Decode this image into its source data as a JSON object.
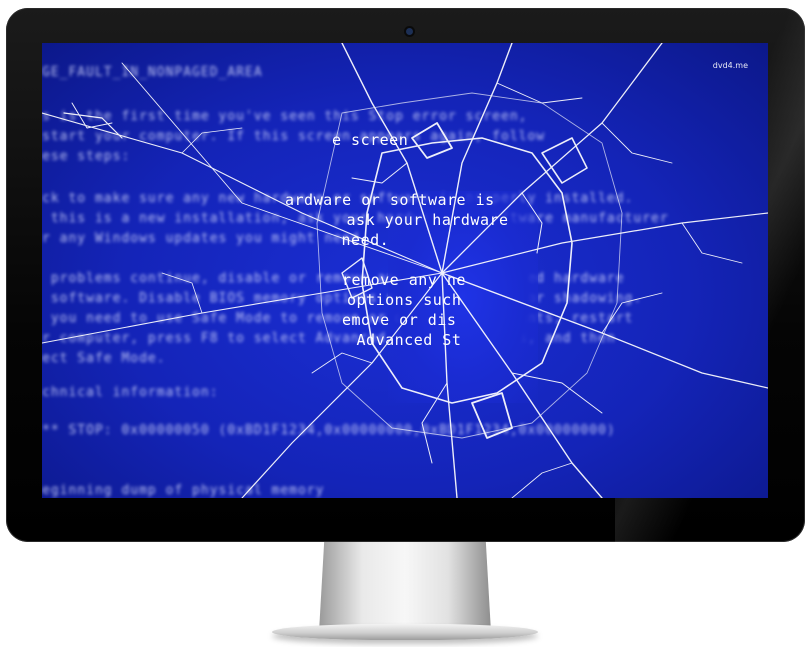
{
  "screen": {
    "watermark": "dvd4.me",
    "blurred_lines": [
      "GE_FAULT_IN_NONPAGED_AREA",
      "s is the first time you've seen this Stop error screen,",
      "start your computer. If this screen appears again, follow",
      "ese steps:",
      "ck to make sure any new hardware or software is properly installed.",
      " this is a new installation, ask your hardware or software manufacturer",
      "r any Windows updates you might need.",
      " problems continue, disable or remove any newly installed hardware",
      " software. Disable BIOS memory options such as caching or shadowing.",
      " you need to use Safe Mode to remove or disable components, restart",
      "r computer, press F8 to select Advanced Startup Options, and then",
      "ect Safe Mode.",
      "chnical information:",
      "** STOP: 0x00000050 (0xBD1F1234,0x00000000,0xBD1F1234,0x00000000)",
      "eginning dump of physical memory"
    ],
    "sharp_lines": [
      "e screen",
      "ardware or software is",
      " ask your hardware",
      " need.",
      "remove any ne",
      "options such",
      "emove or dis",
      " Advanced St"
    ]
  },
  "colors": {
    "bezel": "#050505",
    "screen_blue": "#1424b8",
    "crack": "#ffffff",
    "stand": "#e9e9e9"
  }
}
